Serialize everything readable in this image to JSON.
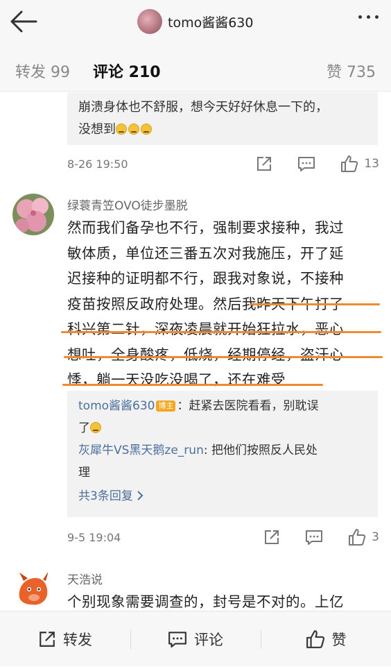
{
  "header": {
    "username": "tomo酱酱630"
  },
  "tabs": {
    "repost": "转发 99",
    "comment": "评论 210",
    "like": "赞 735"
  },
  "comments": [
    {
      "reply_text": "崩溃身体也不舒服，想今天好好休息一下的，",
      "reply_text2": "没想到",
      "time": "8-26 19:50",
      "likes": "13"
    },
    {
      "username": "绿蓑青笠OVO徒步墨脱",
      "lines": [
        "然而我们备孕也不行，强制要求接种，我过",
        "敏体质，单位还三番五次对我施压，开了延",
        "迟接种的证明都不行，跟我对象说，不接种",
        "疫苗按照反政府处理。然后我昨天下午打了",
        "科兴第二针，深夜凌晨就开始狂拉水，恶心",
        "想吐，全身酸疼，低烧，经期停经，盗汗心",
        "悸，躺一天没吃没喝了，还在难受"
      ],
      "replies": [
        {
          "name": "tomo酱酱630",
          "badge": "博主",
          "text": "：赶紧去医院看看，别耽误",
          "text2": "了"
        },
        {
          "name": "灰犀牛VS黑天鹅ze_run",
          "text": ": 把他们按照反人民处",
          "text2": "理"
        }
      ],
      "more_replies": "共3条回复 ",
      "time": "9-5 19:04",
      "likes": "3"
    },
    {
      "username": "天浩说",
      "line1": "个别现象需要调查的，封号是不对的。上亿"
    }
  ],
  "bottom": {
    "repost": "转发",
    "comment": "评论",
    "like": "赞"
  },
  "colors": {
    "accent": "#ff8200",
    "link": "#4b6f9e",
    "underline": "#f08a2e"
  },
  "icons": [
    "back-arrow-icon",
    "more-dots-icon",
    "share-icon",
    "comment-icon",
    "thumbs-up-icon",
    "chevron-right-icon"
  ]
}
